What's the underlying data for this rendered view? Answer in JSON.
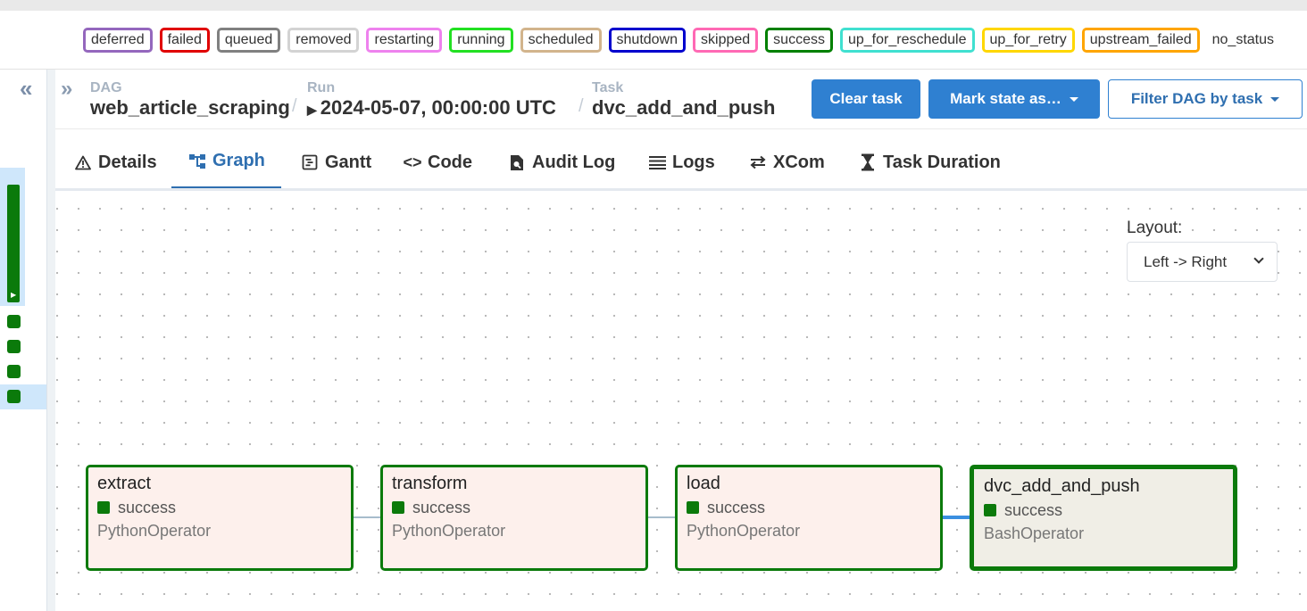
{
  "legend": [
    "deferred",
    "failed",
    "queued",
    "removed",
    "restarting",
    "running",
    "scheduled",
    "shutdown",
    "skipped",
    "success",
    "up_for_reschedule",
    "up_for_retry",
    "upstream_failed"
  ],
  "legend_colors": [
    "#9467bd",
    "#e00000",
    "#808080",
    "#d3d3d3",
    "#ee82ee",
    "#00ff00",
    "#d2b48c",
    "#0000cd",
    "#ff69b4",
    "#008000",
    "#40e0d0",
    "#ffd700",
    "#ffa500"
  ],
  "legend_no_status": "no_status",
  "breadcrumb": {
    "dag_label": "DAG",
    "dag_value": "web_article_scraping",
    "run_label": "Run",
    "run_value": "2024-05-07, 00:00:00 UTC",
    "task_label": "Task",
    "task_value": "dvc_add_and_push"
  },
  "buttons": {
    "clear_task": "Clear task",
    "mark_state": "Mark state as…",
    "filter_dag": "Filter DAG by task"
  },
  "tabs": [
    {
      "label": "Details",
      "icon": "warning-icon"
    },
    {
      "label": "Graph",
      "icon": "graph-icon"
    },
    {
      "label": "Gantt",
      "icon": "gantt-icon"
    },
    {
      "label": "Code",
      "icon": "code-icon"
    },
    {
      "label": "Audit Log",
      "icon": "audit-log-icon"
    },
    {
      "label": "Logs",
      "icon": "logs-icon"
    },
    {
      "label": "XCom",
      "icon": "xcom-icon"
    },
    {
      "label": "Task Duration",
      "icon": "hourglass-icon"
    }
  ],
  "active_tab": "Graph",
  "layout": {
    "label": "Layout:",
    "value": "Left -> Right"
  },
  "nodes": [
    {
      "name": "extract",
      "state": "success",
      "operator": "PythonOperator"
    },
    {
      "name": "transform",
      "state": "success",
      "operator": "PythonOperator"
    },
    {
      "name": "load",
      "state": "success",
      "operator": "PythonOperator"
    },
    {
      "name": "dvc_add_and_push",
      "state": "success",
      "operator": "BashOperator"
    }
  ],
  "colors": {
    "accent": "#2f80d1",
    "success": "#0b7a0b",
    "node_bg": "#fdf0ec"
  }
}
